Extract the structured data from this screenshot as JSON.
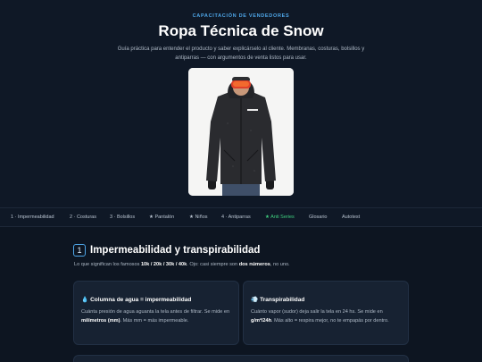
{
  "hero": {
    "eyebrow": "CAPACITACIÓN DE VENDEDORES",
    "title": "Ropa Técnica de Snow",
    "subtitle": "Guía práctica para entender el producto y saber explicárselo al cliente. Membranas, costuras, bolsillos y antiparras — con argumentos de venta listos para usar."
  },
  "nav": {
    "items": [
      {
        "label": "1 · Impermeabilidad",
        "active": false
      },
      {
        "label": "2 · Costuras",
        "active": false
      },
      {
        "label": "3 · Bolsillos",
        "active": false
      },
      {
        "label": "★ Pantalón",
        "active": false
      },
      {
        "label": "★ Niños",
        "active": false
      },
      {
        "label": "4 · Antiparras",
        "active": false
      },
      {
        "label": "★ Anti Series",
        "active": true
      },
      {
        "label": "Glosario",
        "active": false
      },
      {
        "label": "Autotest",
        "active": false
      }
    ]
  },
  "section": {
    "number": "1",
    "title": "Impermeabilidad y transpirabilidad",
    "desc_pre": "Lo que significan los famosos ",
    "desc_bold1": "10k / 20k / 30k / 40k",
    "desc_mid": ". Ojo: casi siempre son ",
    "desc_bold2": "dos números",
    "desc_post": ", no uno."
  },
  "cards": [
    {
      "icon": "💧",
      "title": "Columna de agua = impermeabilidad",
      "body_pre": "Cuánta presión de agua aguanta la tela antes de filtrar. Se mide en ",
      "body_bold": "milímetros (mm)",
      "body_post": ". Más mm = más impermeable."
    },
    {
      "icon": "💨",
      "title": "Transpirabilidad",
      "body_pre": "Cuánto vapor (sudor) deja salir la tela en 24 hs. Se mide en ",
      "body_bold": "g/m²/24h",
      "body_post": ". Más alto = respira mejor, no te empapás por dentro."
    }
  ],
  "colors": {
    "accent": "#4ea6e8",
    "active_nav": "#3fd07f",
    "background": "#0d1521",
    "card": "#172232"
  }
}
